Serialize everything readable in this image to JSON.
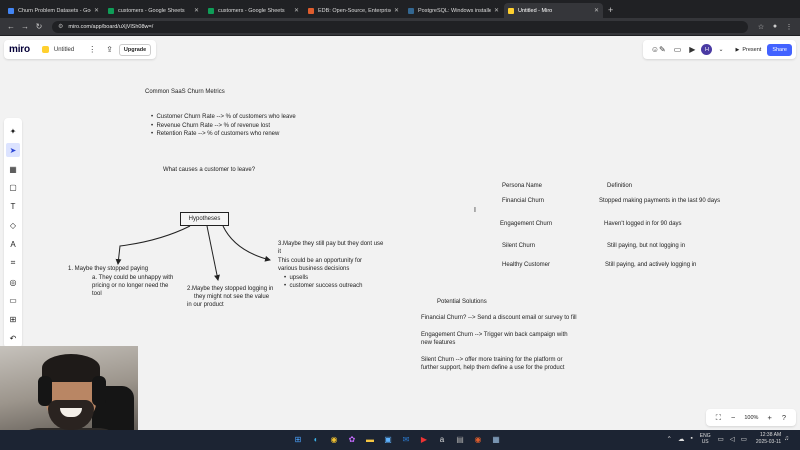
{
  "browser": {
    "tabs": [
      {
        "title": "Churn Problem Datasets - Goog",
        "color": "#4285f4",
        "active": false
      },
      {
        "title": "customers - Google Sheets",
        "color": "#0f9d58",
        "active": false
      },
      {
        "title": "customers - Google Sheets",
        "color": "#0f9d58",
        "active": false
      },
      {
        "title": "EDB: Open-Source, Enterprise P",
        "color": "#e05d2d",
        "active": false
      },
      {
        "title": "PostgreSQL: Windows installers",
        "color": "#336791",
        "active": false
      },
      {
        "title": "Untitled - Miro",
        "color": "#ffd02f",
        "active": true
      }
    ],
    "new_tab": "+",
    "url": "miro.com/app/board/uXjVlSh08w=/"
  },
  "miro": {
    "logo": "miro",
    "board_name": "Untitled",
    "upgrade": "Upgrade",
    "present": "Present",
    "share": "Share",
    "avatar_initial": "H",
    "zoom": "100%"
  },
  "canvas": {
    "metrics_title": "Common SaaS Churn Metrics",
    "metrics": [
      "Customer Churn Rate --> % of customers who leave",
      "Revenue Churn Rate --> % of revenue lost",
      "Retention Rate --> % of customers who renew"
    ],
    "question": "What causes a customer to leave?",
    "hypotheses_label": "Hypotheses",
    "hyp1": {
      "line1": "1. Maybe they stopped paying",
      "line2": "a. They could be unhappy with",
      "line3": "pricing or no longer need the",
      "line4": "tool"
    },
    "hyp2": {
      "line1": "2.Maybe they stopped logging in",
      "line2": "they might not see the value",
      "line3": "in our product"
    },
    "hyp3": {
      "line1": "3.Maybe they still pay but they dont use",
      "line2": "it",
      "line3": "This could be an opportunity for",
      "line4": "various business decisions",
      "bullet1": "upsells",
      "bullet2": "customer success outreach"
    },
    "persona_header": "Persona Name",
    "definition_header": "Definition",
    "personas": [
      {
        "name": "Financial Churn",
        "definition": "Stopped making payments in the last 90 days"
      },
      {
        "name": "Engagement Churn",
        "definition": "Haven't logged in for 90 days"
      },
      {
        "name": "Silent Churn",
        "definition": "Still paying, but not logging in"
      },
      {
        "name": "Healthy Customer",
        "definition": "Still paying, and actively logging in"
      }
    ],
    "solutions_title": "Potential Solutions",
    "solution1": "Financial Churn? --> Send a discount email or survey to fill",
    "solution2_line1": "Engagement Churn --> Trigger win back campaign with",
    "solution2_line2": "new features",
    "solution3_line1": "Silent Churn --> offer more training for the platform or",
    "solution3_line2": "further support, help them define a use for the product"
  },
  "taskbar": {
    "lang_line1": "ENG",
    "lang_line2": "US",
    "time": "12:38 AM",
    "date": "2025-03-11"
  }
}
